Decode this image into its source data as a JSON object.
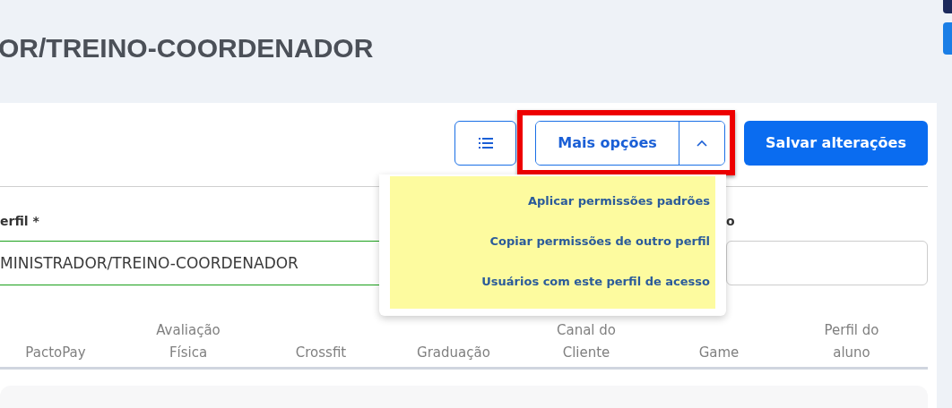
{
  "page_title": "OR/TREINO-COORDENADOR",
  "toolbar": {
    "more_options": {
      "label": "Mais opções",
      "expanded": true,
      "highlighted": true
    },
    "save_button": "Salvar alterações"
  },
  "dropdown_menu": {
    "items": [
      {
        "label": "Aplicar permissões padrões"
      },
      {
        "label": "Copiar permissões de outro perfil"
      },
      {
        "label": "Usuários com este perfil de acesso"
      }
    ]
  },
  "form": {
    "fields": [
      {
        "label": "erfil *",
        "value": "MINISTRADOR/TREINO-COORDENADOR",
        "valid": true
      },
      {
        "label": "o",
        "valid": false
      }
    ]
  },
  "tabs": [
    {
      "label": "PactoPay"
    },
    {
      "label": "Avaliação Física"
    },
    {
      "label": "Crossfit"
    },
    {
      "label": "Graduação"
    },
    {
      "label": "Canal do Cliente"
    },
    {
      "label": "Game"
    },
    {
      "label": "Perfil do aluno"
    }
  ]
}
